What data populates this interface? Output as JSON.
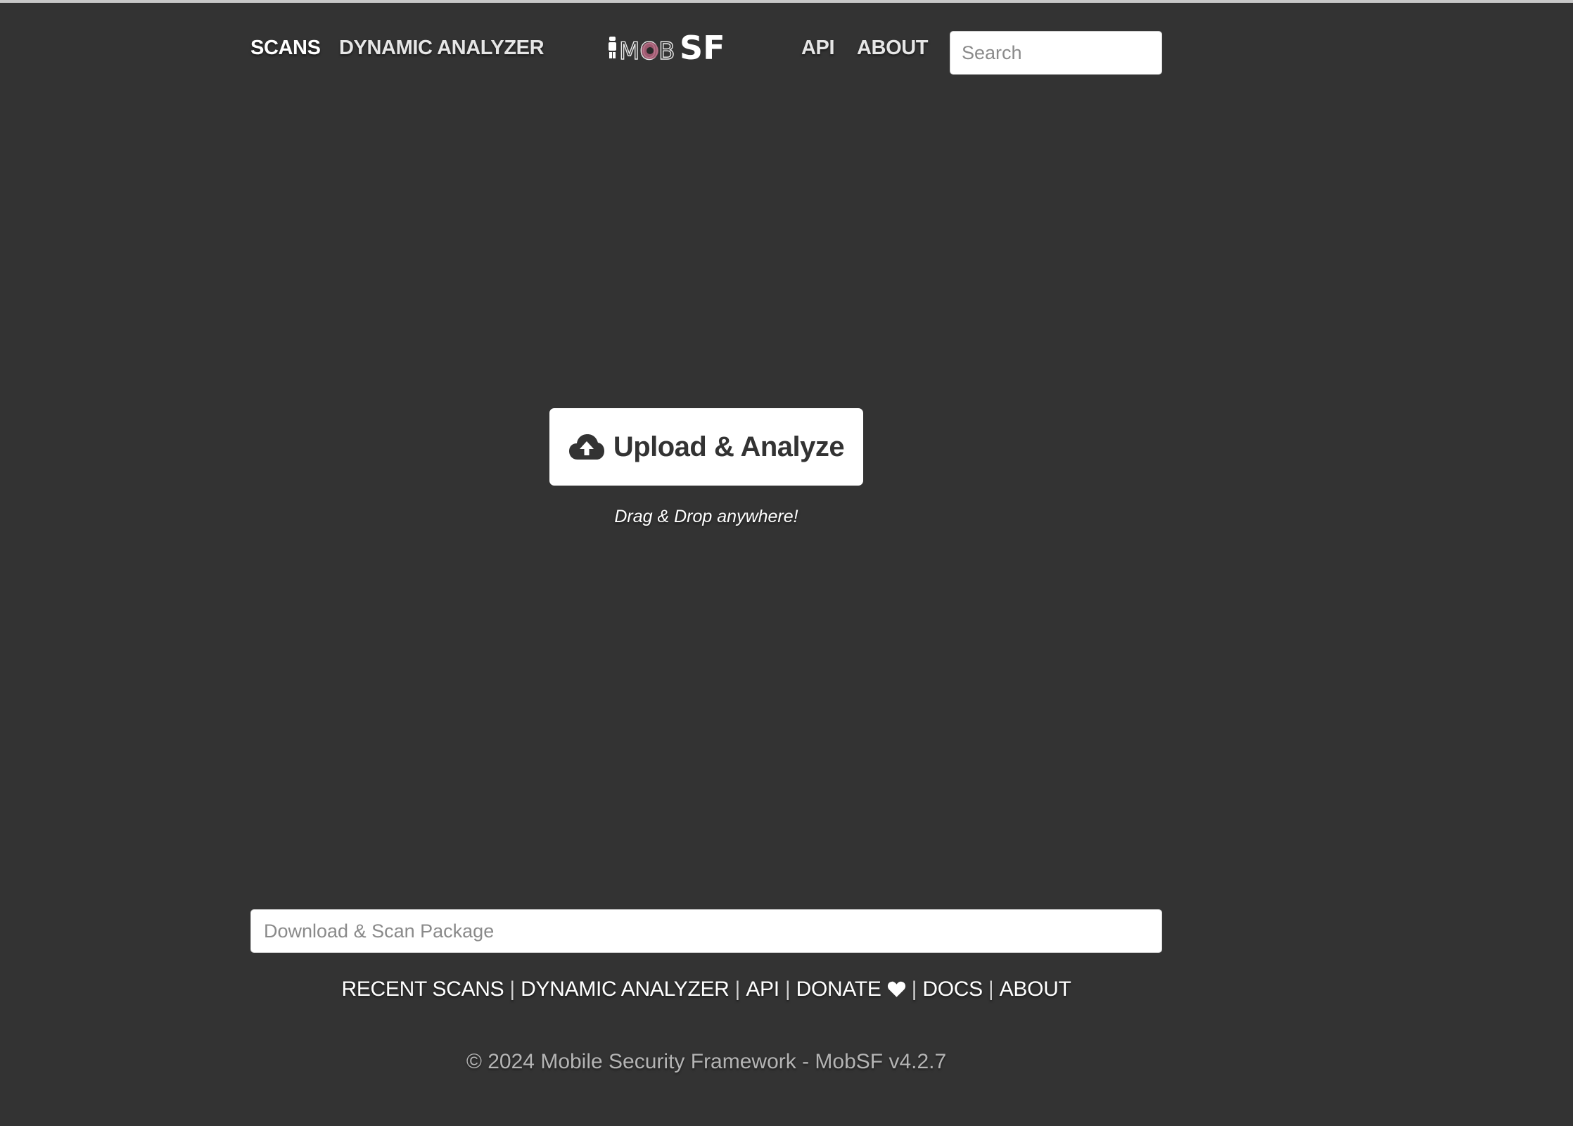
{
  "header": {
    "nav_left": [
      {
        "label": "SCANS",
        "active": true
      },
      {
        "label": "DYNAMIC ANALYZER",
        "active": false
      }
    ],
    "nav_right": [
      {
        "label": "API"
      },
      {
        "label": "ABOUT"
      }
    ],
    "logo": {
      "text_light": "MOB",
      "text_bold": "SF",
      "icon": "mobsf-robot-logo"
    },
    "search": {
      "placeholder": "Search",
      "value": ""
    }
  },
  "main": {
    "upload_button": {
      "label": "Upload & Analyze",
      "icon": "cloud-upload-icon"
    },
    "drag_hint": "Drag & Drop anywhere!"
  },
  "footer": {
    "package_input": {
      "placeholder": "Download & Scan Package",
      "value": ""
    },
    "links": [
      {
        "label": "RECENT SCANS"
      },
      {
        "label": "DYNAMIC ANALYZER"
      },
      {
        "label": "API"
      },
      {
        "label": "DONATE",
        "icon": "heart-icon"
      },
      {
        "label": "DOCS"
      },
      {
        "label": "ABOUT"
      }
    ],
    "separator": "|",
    "copyright": "© 2024 Mobile Security Framework - MobSF v4.2.7"
  },
  "colors": {
    "background": "#333333",
    "text": "#ffffff",
    "button_text": "#333333",
    "logo_accent": "#b0607a"
  }
}
